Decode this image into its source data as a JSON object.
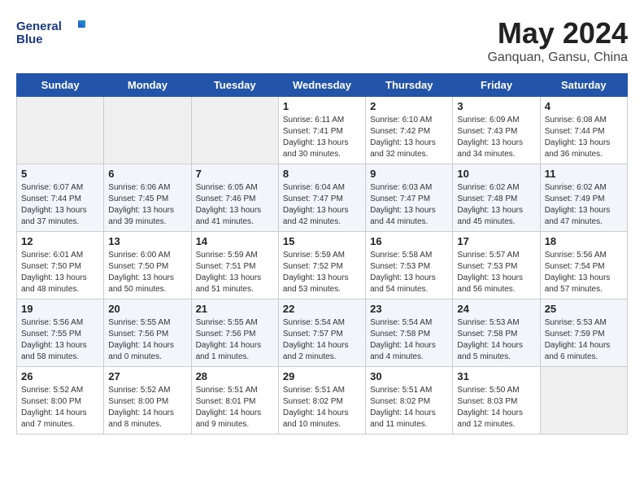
{
  "header": {
    "logo_line1": "General",
    "logo_line2": "Blue",
    "month_year": "May 2024",
    "location": "Ganquan, Gansu, China"
  },
  "weekdays": [
    "Sunday",
    "Monday",
    "Tuesday",
    "Wednesday",
    "Thursday",
    "Friday",
    "Saturday"
  ],
  "weeks": [
    [
      {
        "day": "",
        "empty": true
      },
      {
        "day": "",
        "empty": true
      },
      {
        "day": "",
        "empty": true
      },
      {
        "day": "1",
        "sunrise": "6:11 AM",
        "sunset": "7:41 PM",
        "daylight": "13 hours and 30 minutes."
      },
      {
        "day": "2",
        "sunrise": "6:10 AM",
        "sunset": "7:42 PM",
        "daylight": "13 hours and 32 minutes."
      },
      {
        "day": "3",
        "sunrise": "6:09 AM",
        "sunset": "7:43 PM",
        "daylight": "13 hours and 34 minutes."
      },
      {
        "day": "4",
        "sunrise": "6:08 AM",
        "sunset": "7:44 PM",
        "daylight": "13 hours and 36 minutes."
      }
    ],
    [
      {
        "day": "5",
        "sunrise": "6:07 AM",
        "sunset": "7:44 PM",
        "daylight": "13 hours and 37 minutes."
      },
      {
        "day": "6",
        "sunrise": "6:06 AM",
        "sunset": "7:45 PM",
        "daylight": "13 hours and 39 minutes."
      },
      {
        "day": "7",
        "sunrise": "6:05 AM",
        "sunset": "7:46 PM",
        "daylight": "13 hours and 41 minutes."
      },
      {
        "day": "8",
        "sunrise": "6:04 AM",
        "sunset": "7:47 PM",
        "daylight": "13 hours and 42 minutes."
      },
      {
        "day": "9",
        "sunrise": "6:03 AM",
        "sunset": "7:47 PM",
        "daylight": "13 hours and 44 minutes."
      },
      {
        "day": "10",
        "sunrise": "6:02 AM",
        "sunset": "7:48 PM",
        "daylight": "13 hours and 45 minutes."
      },
      {
        "day": "11",
        "sunrise": "6:02 AM",
        "sunset": "7:49 PM",
        "daylight": "13 hours and 47 minutes."
      }
    ],
    [
      {
        "day": "12",
        "sunrise": "6:01 AM",
        "sunset": "7:50 PM",
        "daylight": "13 hours and 48 minutes."
      },
      {
        "day": "13",
        "sunrise": "6:00 AM",
        "sunset": "7:50 PM",
        "daylight": "13 hours and 50 minutes."
      },
      {
        "day": "14",
        "sunrise": "5:59 AM",
        "sunset": "7:51 PM",
        "daylight": "13 hours and 51 minutes."
      },
      {
        "day": "15",
        "sunrise": "5:59 AM",
        "sunset": "7:52 PM",
        "daylight": "13 hours and 53 minutes."
      },
      {
        "day": "16",
        "sunrise": "5:58 AM",
        "sunset": "7:53 PM",
        "daylight": "13 hours and 54 minutes."
      },
      {
        "day": "17",
        "sunrise": "5:57 AM",
        "sunset": "7:53 PM",
        "daylight": "13 hours and 56 minutes."
      },
      {
        "day": "18",
        "sunrise": "5:56 AM",
        "sunset": "7:54 PM",
        "daylight": "13 hours and 57 minutes."
      }
    ],
    [
      {
        "day": "19",
        "sunrise": "5:56 AM",
        "sunset": "7:55 PM",
        "daylight": "13 hours and 58 minutes."
      },
      {
        "day": "20",
        "sunrise": "5:55 AM",
        "sunset": "7:56 PM",
        "daylight": "14 hours and 0 minutes."
      },
      {
        "day": "21",
        "sunrise": "5:55 AM",
        "sunset": "7:56 PM",
        "daylight": "14 hours and 1 minutes."
      },
      {
        "day": "22",
        "sunrise": "5:54 AM",
        "sunset": "7:57 PM",
        "daylight": "14 hours and 2 minutes."
      },
      {
        "day": "23",
        "sunrise": "5:54 AM",
        "sunset": "7:58 PM",
        "daylight": "14 hours and 4 minutes."
      },
      {
        "day": "24",
        "sunrise": "5:53 AM",
        "sunset": "7:58 PM",
        "daylight": "14 hours and 5 minutes."
      },
      {
        "day": "25",
        "sunrise": "5:53 AM",
        "sunset": "7:59 PM",
        "daylight": "14 hours and 6 minutes."
      }
    ],
    [
      {
        "day": "26",
        "sunrise": "5:52 AM",
        "sunset": "8:00 PM",
        "daylight": "14 hours and 7 minutes."
      },
      {
        "day": "27",
        "sunrise": "5:52 AM",
        "sunset": "8:00 PM",
        "daylight": "14 hours and 8 minutes."
      },
      {
        "day": "28",
        "sunrise": "5:51 AM",
        "sunset": "8:01 PM",
        "daylight": "14 hours and 9 minutes."
      },
      {
        "day": "29",
        "sunrise": "5:51 AM",
        "sunset": "8:02 PM",
        "daylight": "14 hours and 10 minutes."
      },
      {
        "day": "30",
        "sunrise": "5:51 AM",
        "sunset": "8:02 PM",
        "daylight": "14 hours and 11 minutes."
      },
      {
        "day": "31",
        "sunrise": "5:50 AM",
        "sunset": "8:03 PM",
        "daylight": "14 hours and 12 minutes."
      },
      {
        "day": "",
        "empty": true
      }
    ]
  ]
}
